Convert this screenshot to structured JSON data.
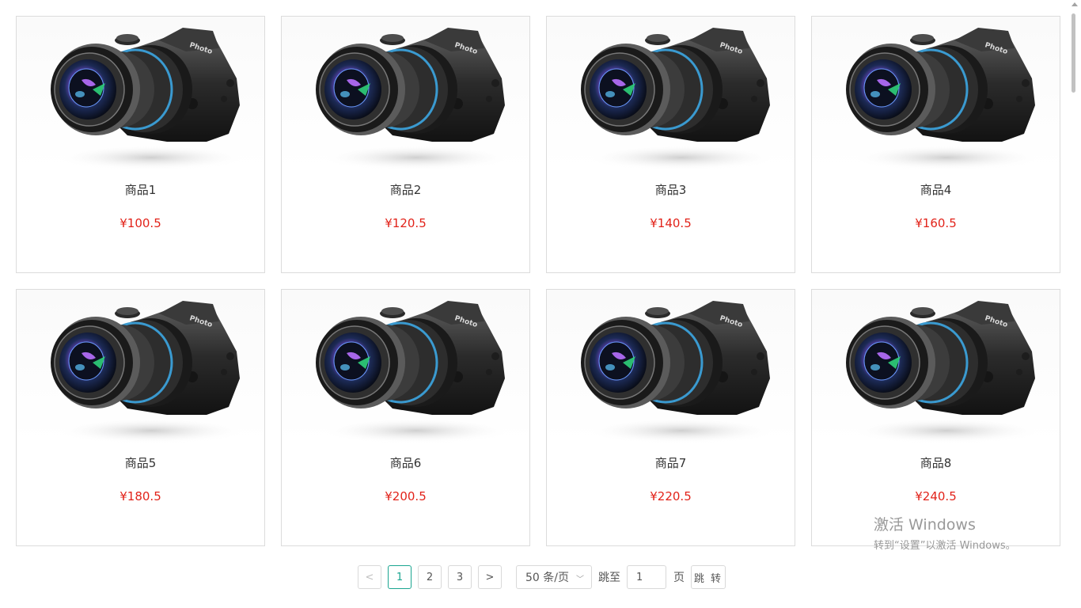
{
  "products": [
    {
      "name": "商品1",
      "price": "¥100.5"
    },
    {
      "name": "商品2",
      "price": "¥120.5"
    },
    {
      "name": "商品3",
      "price": "¥140.5"
    },
    {
      "name": "商品4",
      "price": "¥160.5"
    },
    {
      "name": "商品5",
      "price": "¥180.5"
    },
    {
      "name": "商品6",
      "price": "¥200.5"
    },
    {
      "name": "商品7",
      "price": "¥220.5"
    },
    {
      "name": "商品8",
      "price": "¥240.5"
    }
  ],
  "product_image_icon": "camera-icon",
  "pagination": {
    "prev_icon": "chevron-left-icon",
    "next_icon": "chevron-right-icon",
    "prev_glyph": "<",
    "next_glyph": ">",
    "pages": [
      "1",
      "2",
      "3"
    ],
    "current_page": "1",
    "page_size": "50 条/页",
    "page_size_arrow": "﹀",
    "jump_to_label": "跳至",
    "jump_value": "1",
    "page_unit_label": "页",
    "jump_button": "跳 转"
  },
  "colors": {
    "price": "#e2231a",
    "accent": "#1aa590",
    "border": "#dcdcdc"
  },
  "watermark": {
    "title": "激活 Windows",
    "subtitle": "转到“设置”以激活 Windows。"
  }
}
